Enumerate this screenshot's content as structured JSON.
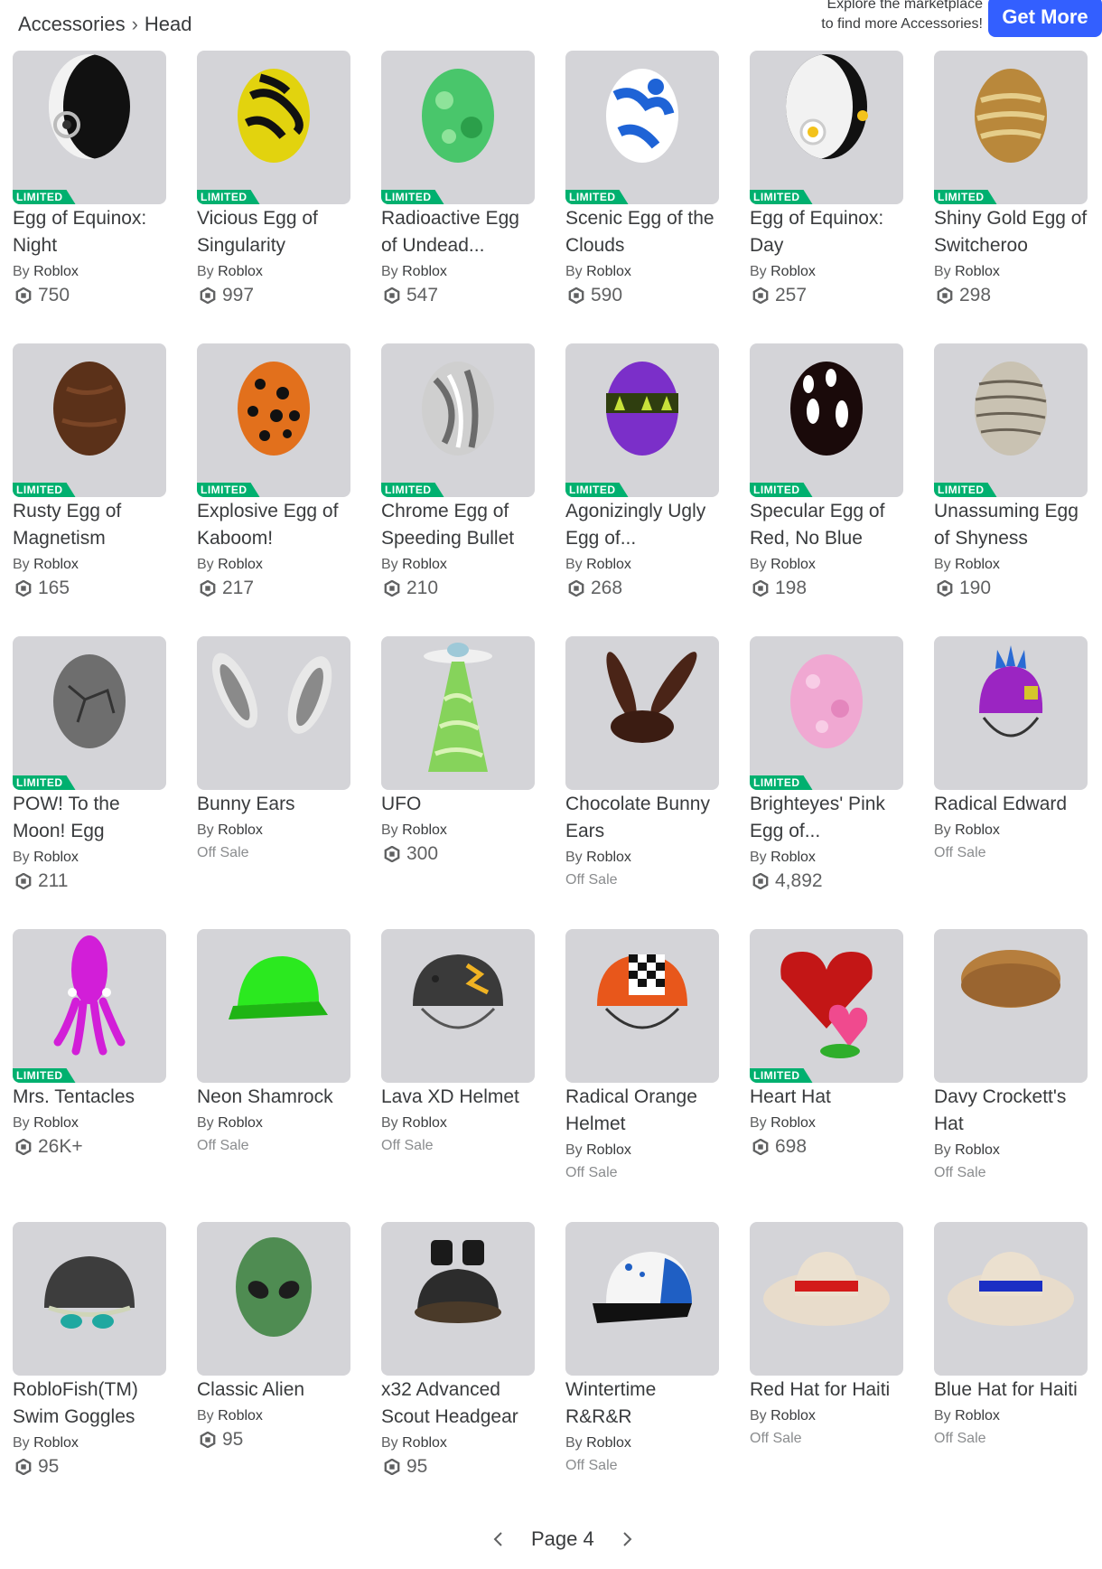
{
  "breadcrumb": {
    "parent": "Accessories",
    "current": "Head"
  },
  "explore": {
    "line1": "Explore the marketplace",
    "line2": "to find more Accessories!",
    "button": "Get More"
  },
  "limited_label": "LIMITED",
  "by_label": "By",
  "colors": {
    "accent": "#335fff",
    "limited": "#00b06f",
    "thumb_bg": "#d4d4d8"
  },
  "items": [
    {
      "name": "Egg of Equinox: Night",
      "creator": "Roblox",
      "price": "750",
      "limited": true,
      "art": "equinox-night"
    },
    {
      "name": "Vicious Egg of Singularity",
      "creator": "Roblox",
      "price": "997",
      "limited": true,
      "art": "vicious"
    },
    {
      "name": "Radioactive Egg of Undead...",
      "creator": "Roblox",
      "price": "547",
      "limited": true,
      "art": "radioactive"
    },
    {
      "name": "Scenic Egg of the Clouds",
      "creator": "Roblox",
      "price": "590",
      "limited": true,
      "art": "clouds"
    },
    {
      "name": "Egg of Equinox: Day",
      "creator": "Roblox",
      "price": "257",
      "limited": true,
      "art": "equinox-day"
    },
    {
      "name": "Shiny Gold Egg of Switcheroo",
      "creator": "Roblox",
      "price": "298",
      "limited": true,
      "art": "gold"
    },
    {
      "name": "Rusty Egg of Magnetism",
      "creator": "Roblox",
      "price": "165",
      "limited": true,
      "art": "rusty"
    },
    {
      "name": "Explosive Egg of Kaboom!",
      "creator": "Roblox",
      "price": "217",
      "limited": true,
      "art": "explosive"
    },
    {
      "name": "Chrome Egg of Speeding Bullet",
      "creator": "Roblox",
      "price": "210",
      "limited": true,
      "art": "chrome"
    },
    {
      "name": "Agonizingly Ugly Egg of...",
      "creator": "Roblox",
      "price": "268",
      "limited": true,
      "art": "ugly"
    },
    {
      "name": "Specular Egg of Red, No Blue",
      "creator": "Roblox",
      "price": "198",
      "limited": true,
      "art": "specular"
    },
    {
      "name": "Unassuming Egg of Shyness",
      "creator": "Roblox",
      "price": "190",
      "limited": true,
      "art": "unassuming"
    },
    {
      "name": "POW! To the Moon! Egg",
      "creator": "Roblox",
      "price": "211",
      "limited": true,
      "art": "pow"
    },
    {
      "name": "Bunny Ears",
      "creator": "Roblox",
      "price": "Off Sale",
      "limited": false,
      "art": "bunny"
    },
    {
      "name": "UFO",
      "creator": "Roblox",
      "price": "300",
      "limited": false,
      "art": "ufo"
    },
    {
      "name": "Chocolate Bunny Ears",
      "creator": "Roblox",
      "price": "Off Sale",
      "limited": false,
      "art": "choco"
    },
    {
      "name": "Brighteyes' Pink Egg of...",
      "creator": "Roblox",
      "price": "4,892",
      "limited": true,
      "art": "pink"
    },
    {
      "name": "Radical Edward",
      "creator": "Roblox",
      "price": "Off Sale",
      "limited": false,
      "art": "edward"
    },
    {
      "name": "Mrs. Tentacles",
      "creator": "Roblox",
      "price": "26K+",
      "limited": true,
      "art": "squid"
    },
    {
      "name": "Neon Shamrock",
      "creator": "Roblox",
      "price": "Off Sale",
      "limited": false,
      "art": "shamrock"
    },
    {
      "name": "Lava XD Helmet",
      "creator": "Roblox",
      "price": "Off Sale",
      "limited": false,
      "art": "lava"
    },
    {
      "name": "Radical Orange Helmet",
      "creator": "Roblox",
      "price": "Off Sale",
      "limited": false,
      "art": "orange"
    },
    {
      "name": "Heart Hat",
      "creator": "Roblox",
      "price": "698",
      "limited": true,
      "art": "heart"
    },
    {
      "name": "Davy Crockett's Hat",
      "creator": "Roblox",
      "price": "Off Sale",
      "limited": false,
      "art": "davy"
    },
    {
      "name": "RobloFish(TM) Swim Goggles",
      "creator": "Roblox",
      "price": "95",
      "limited": false,
      "art": "goggles"
    },
    {
      "name": "Classic Alien",
      "creator": "Roblox",
      "price": "95",
      "limited": false,
      "art": "alien"
    },
    {
      "name": "x32 Advanced Scout Headgear",
      "creator": "Roblox",
      "price": "95",
      "limited": false,
      "art": "scout"
    },
    {
      "name": "Wintertime R&R&R",
      "creator": "Roblox",
      "price": "Off Sale",
      "limited": false,
      "art": "winter"
    },
    {
      "name": "Red Hat for Haiti",
      "creator": "Roblox",
      "price": "Off Sale",
      "limited": false,
      "art": "redhat"
    },
    {
      "name": "Blue Hat for Haiti",
      "creator": "Roblox",
      "price": "Off Sale",
      "limited": false,
      "art": "bluehat"
    }
  ],
  "pagination": {
    "label": "Page 4",
    "prev_icon": "chevron-left-icon",
    "next_icon": "chevron-right-icon"
  }
}
